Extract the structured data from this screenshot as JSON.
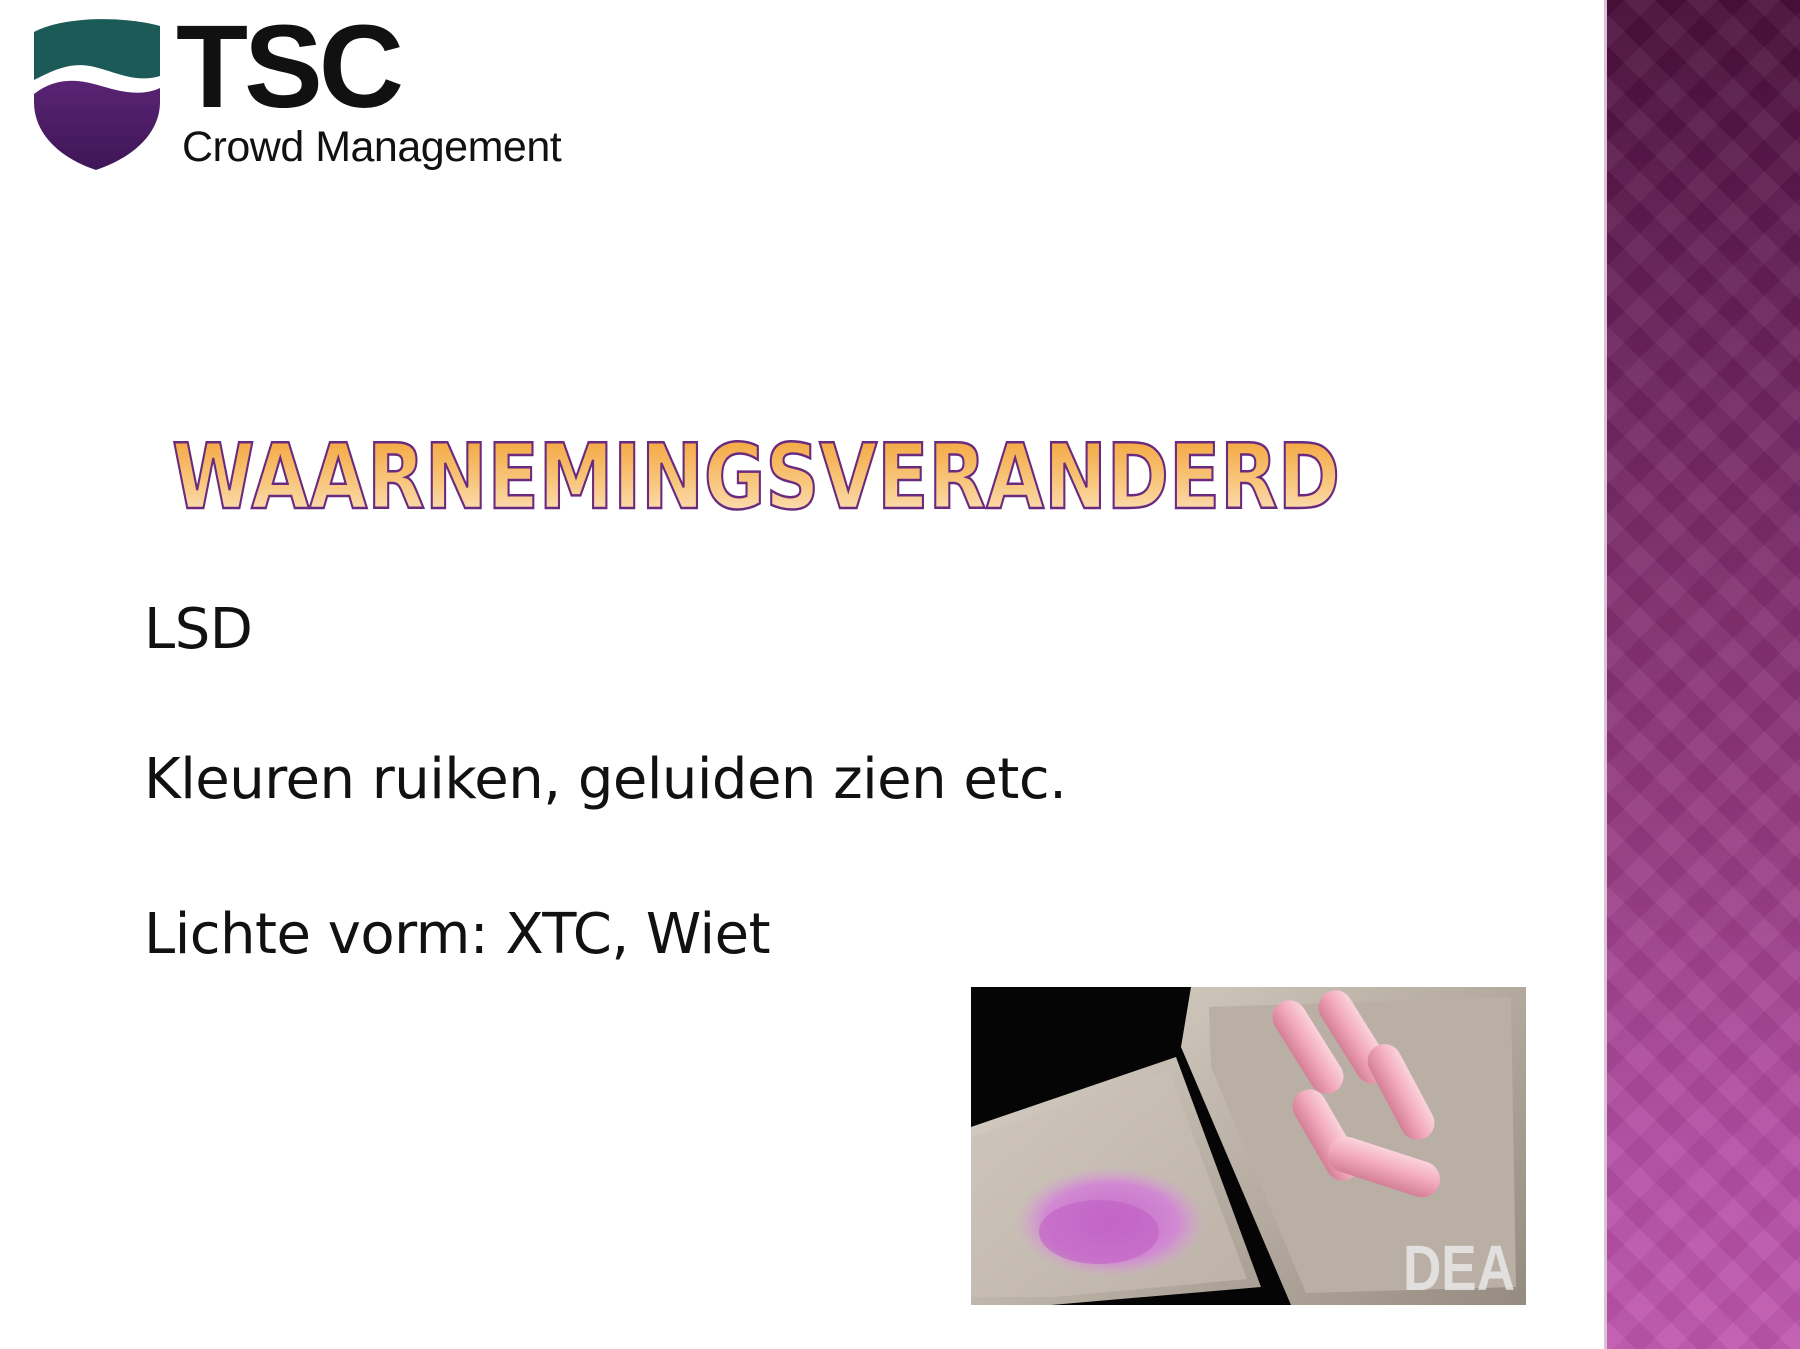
{
  "logo": {
    "name": "TSC",
    "subtitle": "Crowd Management",
    "colors": {
      "teal": "#1b5a57",
      "purple": "#4a1c61"
    }
  },
  "slide": {
    "title": "WAARNEMINGSVERANDERD",
    "lines": [
      "LSD",
      "Kleuren ruiken, geluiden zien etc.",
      "Lichte vorm: XTC, Wiet"
    ]
  },
  "photo": {
    "watermark": "DEA",
    "description_icon": "pink-capsules-photo"
  },
  "colors": {
    "title_gradient_top": "#f4a73c",
    "title_gradient_bottom": "#fde6c6",
    "title_outline": "#6a2a80",
    "band_top": "#4a0f3b",
    "band_bottom": "#bf56ad"
  }
}
